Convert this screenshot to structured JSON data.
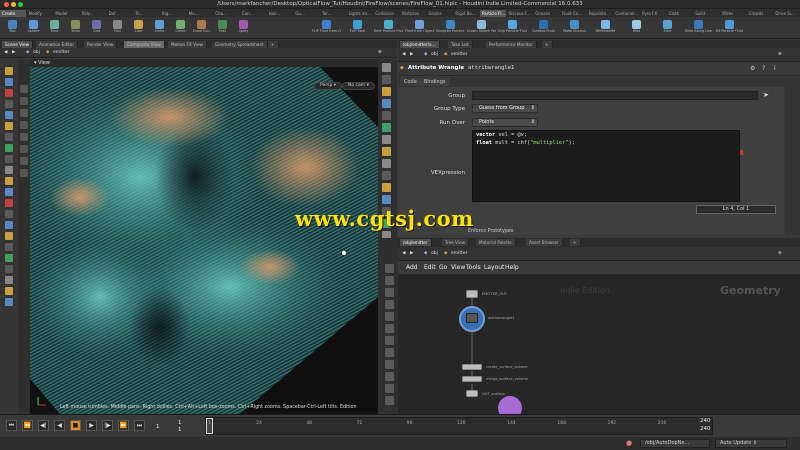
{
  "window": {
    "title": "/Users/markfancher/Desktop/OpticalFlow_Tut/Houdini/FireFlow/scenes/FireFlow_01.hiplc - Houdini Indie Limited-Commercial 16.0.633"
  },
  "shelf": {
    "tabs": [
      "Create",
      "Modify",
      "Model",
      "Poly...",
      "Def...",
      "Te...",
      "Rig...",
      "Mu...",
      "Cha...",
      "Con...",
      "Hair...",
      "Gu...",
      "Ter...",
      "Lights an...",
      "Collisions",
      "Particles",
      "Grains",
      "Rigid Bo...",
      "Particle Fl...",
      "Viscous F...",
      "Oceans",
      "Fluid Co...",
      "Populate...",
      "Container...",
      "Pyro FX",
      "Cloth",
      "Solid",
      "Wires",
      "Crowds",
      "Drive Si..."
    ],
    "tools_left": [
      "Box",
      "Sphere",
      "Tube",
      "Torus",
      "Grid",
      "Null",
      "Line",
      "Circle",
      "Curve",
      "Draw Curve",
      "Path",
      "Spray"
    ],
    "tools_right": [
      "FLIP Fluid from Object",
      "FLIP Tank",
      "Emit Particle Fluid",
      "Fluid from Objects",
      "Sculpted Particle Fluid",
      "Crown Splash Particle Fluid",
      "Drip Particle Fluid",
      "Surface Fluid",
      "Make Viscous",
      "Whitewater",
      "Mist",
      "Slice",
      "Slide Along Line",
      "Fill Particle Fluid"
    ]
  },
  "left_pane": {
    "tabs": [
      "Scene View",
      "Animation Editor",
      "Render View",
      "Composite View",
      "Motion FX View",
      "Geometry Spreadsheet"
    ],
    "path": [
      "obj",
      "emitter"
    ],
    "view_label": "View",
    "persp_button": "Persp",
    "cam_button": "No cam",
    "hint": "Left mouse tumbles. Middle pans. Right dollies. Ctrl+Alt+Left box-zooms. Ctrl+Right zooms. Spacebar-Ctrl-Left tilts.",
    "hint_suffix": "Edition"
  },
  "param_pane": {
    "tabs": [
      "/obj/emitter/a...",
      "Take List",
      "Performance Monitor"
    ],
    "path": [
      "obj",
      "emitter"
    ],
    "node_type": "Attribute Wrangle",
    "node_name": "attribwrangle1",
    "subtabs": [
      "Code",
      "Bindings"
    ],
    "params": {
      "group_label": "Group",
      "group_value": "",
      "group_type_label": "Group Type",
      "group_type_value": "Guess from Group",
      "run_over_label": "Run Over",
      "run_over_value": "Points",
      "vex_label": "VEXpression"
    },
    "code": {
      "line1_kw": "vector",
      "line1_rest": " vel = @v;",
      "line2_kw": "float",
      "line2_mid": " mult = chf(",
      "line2_str": "\"multiplier\"",
      "line2_end": ");"
    },
    "cursor_status": "Ln 4, Col 1",
    "partial_row": "Enforce Prototypes"
  },
  "network_pane": {
    "tabs": [
      "/obj/emitter",
      "Tree View",
      "Material Palette",
      "Asset Browser"
    ],
    "path": [
      "obj",
      "emitter"
    ],
    "menu": [
      "Add",
      "Edit",
      "Go",
      "View",
      "Tools",
      "Layout",
      "Help"
    ],
    "watermark": "Indie Edition",
    "context": "Geometry",
    "nodes": [
      {
        "label": "EMITTER_OUT"
      },
      {
        "label": "attribwrangle1"
      },
      {
        "label": "create_surface_volume"
      },
      {
        "label": "merge_surface_volume"
      },
      {
        "label": "OUT_surface"
      }
    ]
  },
  "timeline": {
    "current_frame": "1",
    "start_frame": "1",
    "range_start": "1",
    "ticks": [
      "1",
      "24",
      "48",
      "72",
      "96",
      "120",
      "144",
      "168",
      "192",
      "216"
    ],
    "end_frames": [
      "240",
      "240"
    ],
    "buttons": [
      "jump-start",
      "prev-key",
      "step-back",
      "play-reverse",
      "stop",
      "play",
      "step-forward",
      "next-key",
      "jump-end"
    ]
  },
  "status_bar": {
    "path_field": "/obj/AutoDopNe...",
    "auto_update": "Auto Update"
  },
  "overlay": {
    "watermark": "www.cgtsj.com"
  },
  "colors": {
    "accent_orange": "#e58a2a",
    "volume_teal": "#3fa3a0",
    "volume_warm": "#b5835a",
    "watermark_yellow": "#ffe400",
    "network_selected": "#3a6fb0",
    "network_purple": "#a76bd6"
  }
}
